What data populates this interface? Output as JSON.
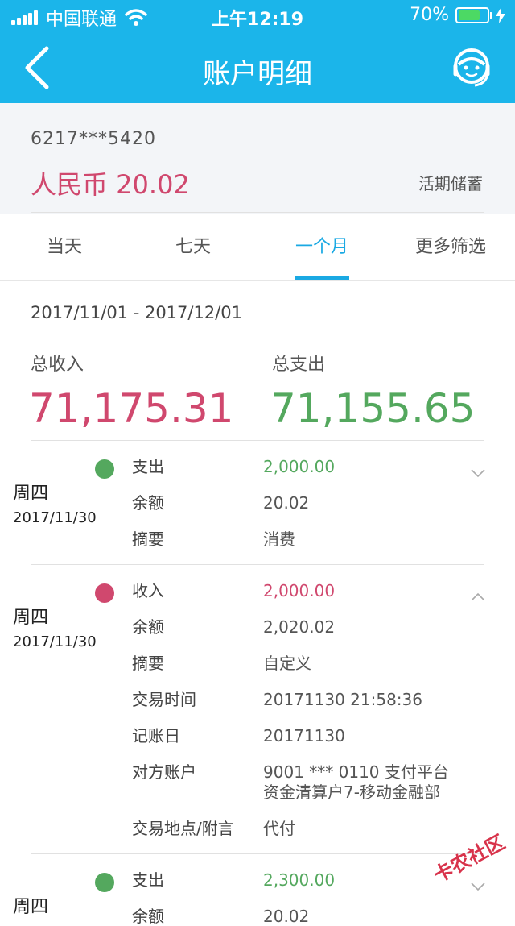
{
  "status_bar": {
    "carrier": "中国联通",
    "time": "上午12:19",
    "battery": "70%"
  },
  "nav": {
    "title": "账户明细",
    "back_icon": "chevron-left-icon",
    "service_icon": "customer-service-icon"
  },
  "account": {
    "number": "6217***5420",
    "balance": "人民币 20.02",
    "type": "活期储蓄"
  },
  "tabs": [
    {
      "label": "当天",
      "active": false
    },
    {
      "label": "七天",
      "active": false
    },
    {
      "label": "一个月",
      "active": true
    },
    {
      "label": "更多筛选",
      "active": false
    }
  ],
  "summary": {
    "range": "2017/11/01 - 2017/12/01",
    "income_label": "总收入",
    "income_value": "71,175.31",
    "expense_label": "总支出",
    "expense_value": "71,155.65"
  },
  "transactions": [
    {
      "weekday": "周四",
      "date": "2017/11/30",
      "kind": "expense",
      "rows": [
        {
          "k": "支出",
          "v": "2,000.00"
        },
        {
          "k": "余额",
          "v": "20.02"
        },
        {
          "k": "摘要",
          "v": "消费"
        }
      ]
    },
    {
      "weekday": "周四",
      "date": "2017/11/30",
      "kind": "income",
      "rows": [
        {
          "k": "收入",
          "v": "2,000.00"
        },
        {
          "k": "余额",
          "v": "2,020.02"
        },
        {
          "k": "摘要",
          "v": "自定义"
        },
        {
          "k": "交易时间",
          "v": "20171130 21:58:36"
        },
        {
          "k": "记账日",
          "v": "20171130"
        },
        {
          "k": "对方账户",
          "v": "9001 *** 0110 支付平台",
          "v2": "资金清算户7-移动金融部"
        },
        {
          "k": "交易地点/附言",
          "v": "代付"
        }
      ]
    },
    {
      "weekday": "周四",
      "kind": "expense",
      "rows": [
        {
          "k": "支出",
          "v": "2,300.00"
        },
        {
          "k": "余额",
          "v": "20.02"
        }
      ]
    }
  ],
  "colors": {
    "header": "#1bb5ea",
    "income": "#d0486e",
    "expense": "#54a85e",
    "accent": "#1aa9e3"
  },
  "watermark": "卡农社区"
}
